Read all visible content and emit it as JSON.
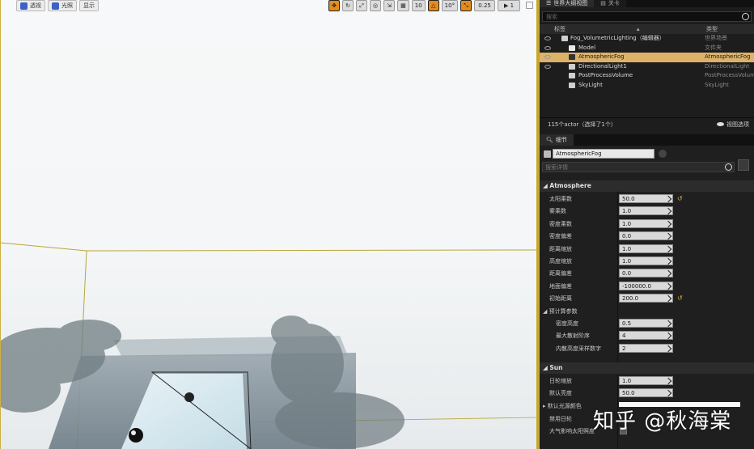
{
  "viewport": {
    "buttons": {
      "perspective": "透视",
      "lighting": "光照",
      "show": "显示"
    },
    "tools": {
      "grid_snap": "10",
      "rotate_snap": "10°",
      "scale_snap": "0.25",
      "camera_speed": "1"
    }
  },
  "outliner": {
    "tab_label": "世界大纲视图",
    "tab2_label": "关卡",
    "search_placeholder": "搜索",
    "col_label": "标签",
    "col_type": "类型",
    "rows": [
      {
        "name": "Fog_VolumetricLighting（编辑器）",
        "type": "世界场景"
      },
      {
        "name": "Model",
        "type": "文件夹"
      },
      {
        "name": "AtmosphericFog",
        "type": "AtmosphericFog"
      },
      {
        "name": "DirectionalLight1",
        "type": "DirectionalLight"
      },
      {
        "name": "PostProcessVolume",
        "type": "PostProcessVolume"
      },
      {
        "name": "SkyLight",
        "type": "SkyLight"
      }
    ],
    "footer_count": "115个actor（选择了1个）",
    "view_options": "视图选项"
  },
  "details": {
    "tab_label": "细节",
    "actor_name": "AtmosphericFog",
    "search_placeholder": "搜索详情",
    "atmosphere": {
      "title": "Atmosphere",
      "props": [
        {
          "label": "太阳乘数",
          "value": "50.0",
          "reset": true
        },
        {
          "label": "雾乘数",
          "value": "1.0"
        },
        {
          "label": "密度乘数",
          "value": "1.0"
        },
        {
          "label": "密度偏差",
          "value": "0.0"
        },
        {
          "label": "距离缩放",
          "value": "1.0"
        },
        {
          "label": "高度缩放",
          "value": "1.0"
        },
        {
          "label": "距离偏差",
          "value": "0.0"
        },
        {
          "label": "地面偏差",
          "value": "-100000.0"
        },
        {
          "label": "初始距离",
          "value": "200.0",
          "reset": true
        }
      ],
      "precompute": {
        "label": "预计算参数",
        "props": [
          {
            "label": "密度高度",
            "value": "0.5"
          },
          {
            "label": "最大散射阶序",
            "value": "4"
          },
          {
            "label": "内散高度采样数字",
            "value": "2"
          }
        ]
      }
    },
    "sun": {
      "title": "Sun",
      "props": [
        {
          "label": "日轮缩放",
          "value": "1.0"
        },
        {
          "label": "默认亮度",
          "value": "50.0"
        }
      ],
      "default_color_label": "默认光源颜色",
      "disable_sun_disk_label": "禁用日轮",
      "atmosphere_affects_label": "大气影响太阳照度"
    }
  },
  "watermark": "知乎 @秋海棠",
  "colors": {
    "accent": "#c7a62f",
    "selection": "#dcb26a",
    "panel": "#1f1f1f"
  }
}
